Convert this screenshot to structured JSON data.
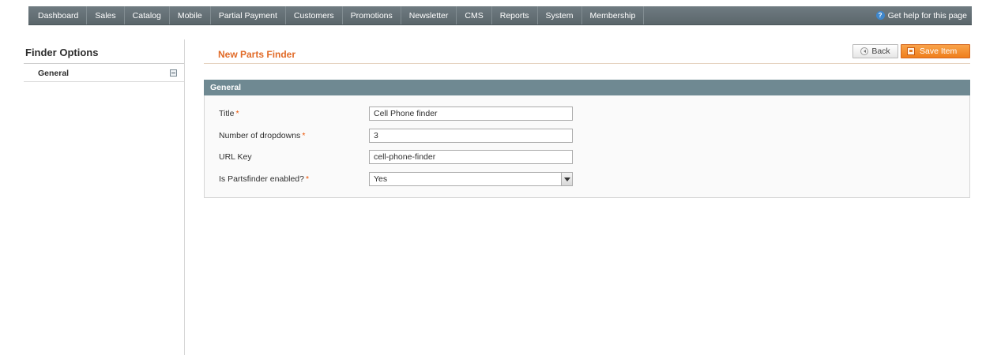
{
  "topnav": {
    "items": [
      "Dashboard",
      "Sales",
      "Catalog",
      "Mobile",
      "Partial Payment",
      "Customers",
      "Promotions",
      "Newsletter",
      "CMS",
      "Reports",
      "System",
      "Membership"
    ],
    "help_text": "Get help for this page"
  },
  "sidebar": {
    "title": "Finder Options",
    "items": [
      {
        "label": "General"
      }
    ]
  },
  "page": {
    "title": "New Parts Finder",
    "back_label": "Back",
    "save_label": "Save Item"
  },
  "fieldset": {
    "title": "General",
    "fields": [
      {
        "label": "Title",
        "required": true,
        "value": "Cell Phone finder",
        "type": "text"
      },
      {
        "label": "Number of dropdowns",
        "required": true,
        "value": "3",
        "type": "text"
      },
      {
        "label": "URL Key",
        "required": false,
        "value": "cell-phone-finder",
        "type": "text"
      },
      {
        "label": "Is Partsfinder enabled?",
        "required": true,
        "value": "Yes",
        "type": "select"
      }
    ]
  },
  "colors": {
    "accent": "#e16b28",
    "nav_bg": "#6f7b81",
    "section_head_bg": "#6f8992"
  }
}
